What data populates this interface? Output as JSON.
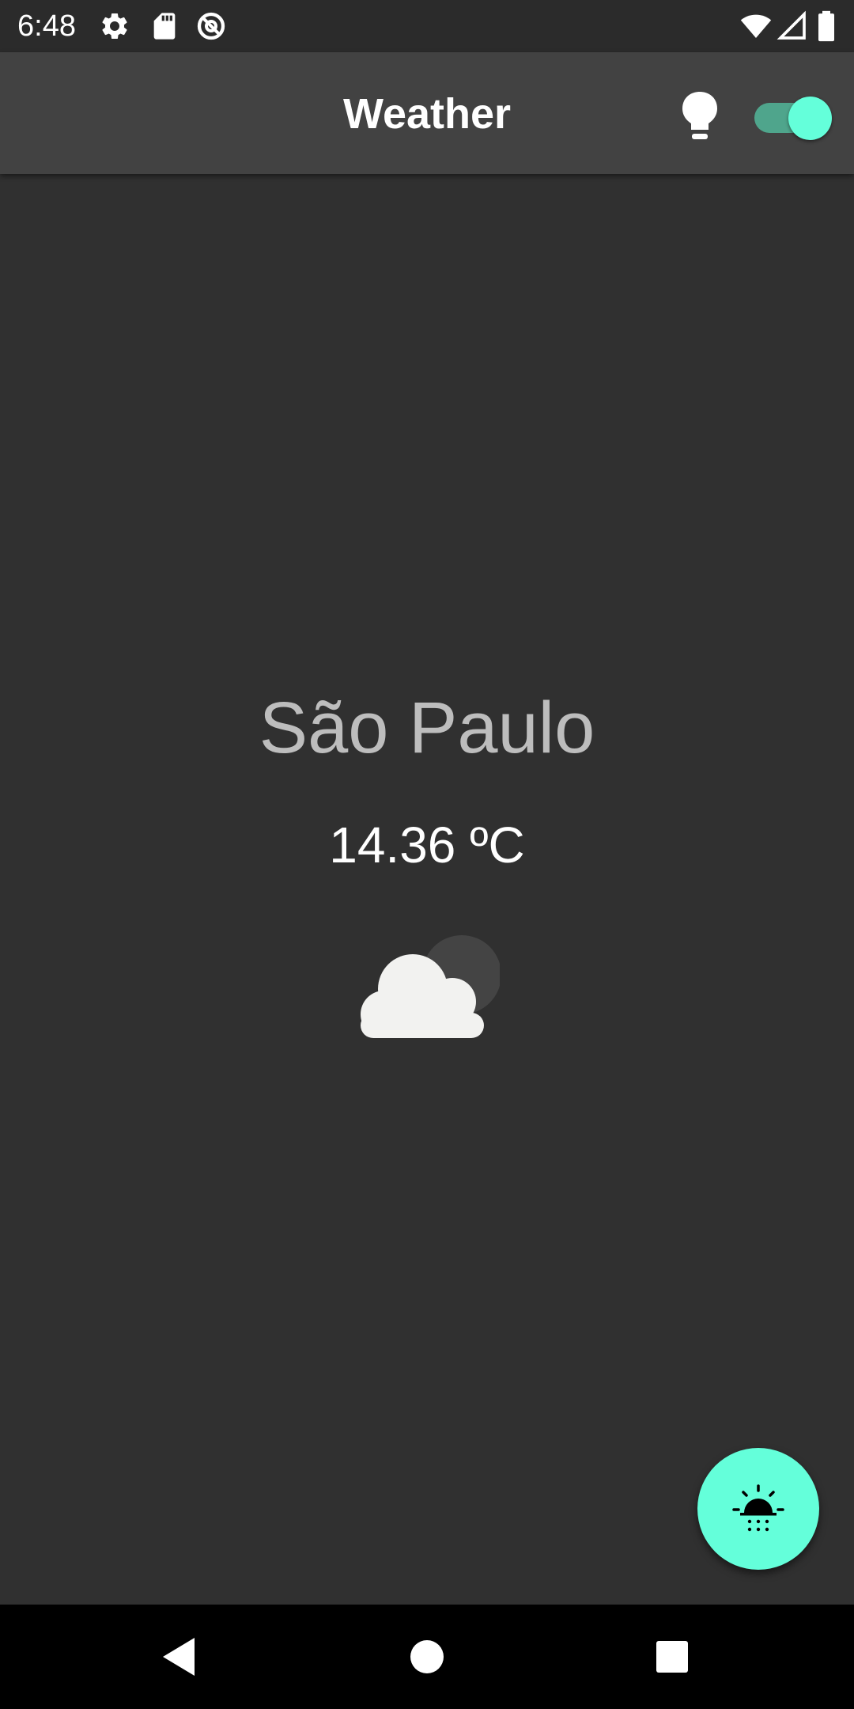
{
  "status_bar": {
    "time": "6:48",
    "icons": [
      "settings-icon",
      "sd-card-icon",
      "no-sync-icon",
      "wifi-icon",
      "signal-icon",
      "battery-icon"
    ]
  },
  "app_bar": {
    "title": "Weather",
    "theme_toggle": {
      "on": true
    },
    "icons": [
      "lightbulb-icon"
    ]
  },
  "weather": {
    "city": "São Paulo",
    "temperature": "14.36 ºC",
    "condition_icon": "cloudy-night-icon"
  },
  "fab": {
    "icon": "sunrise-icon"
  },
  "nav_bar": {
    "icons": [
      "back-icon",
      "home-icon",
      "recents-icon"
    ]
  },
  "colors": {
    "background": "#303030",
    "app_bar": "#424242",
    "accent": "#64ffda",
    "city_text": "#bdbdbd"
  }
}
